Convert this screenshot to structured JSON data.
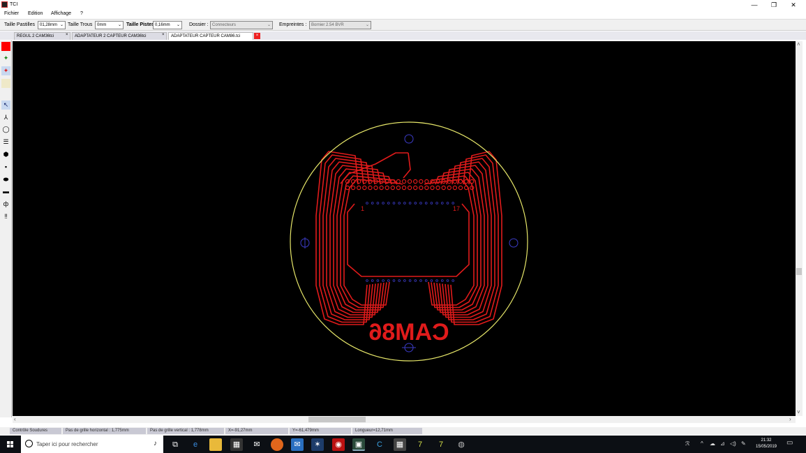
{
  "window": {
    "title": "TCI",
    "minimize": "—",
    "restore": "❐",
    "close": "✕"
  },
  "menu": [
    "Fichier",
    "Edition",
    "Affichage",
    "?"
  ],
  "toolbar": {
    "pastilles_label": "Taille Pastilles",
    "pastilles_value": "01,28mm",
    "trous_label": "Taille Trous",
    "trous_value": "0mm",
    "pistes_label": "Taille Pistes",
    "pistes_value": "0,16mm",
    "dossier_label": "Dossier :",
    "dossier_value": "Connecteurs",
    "empreintes_label": "Empreintes :",
    "empreintes_value": "Bornier 2.54 BVR"
  },
  "tabs": [
    {
      "label": "REGUL 2 CAM36tci"
    },
    {
      "label": "ADAPTATEUR 2 CAPTEUR CAM36tci"
    },
    {
      "label": "ADAPTATEUR CAPTEUR CAM86.tci"
    }
  ],
  "tab_close": "×",
  "tools": [
    "■",
    "✦",
    "✦",
    "▭",
    "↖",
    "⅄",
    "◯",
    "☰",
    "⬢",
    "▪",
    "⬬",
    "▬",
    "ф",
    "‼"
  ],
  "board": {
    "silk_text": "CAM86",
    "pin_first": "1",
    "pin_last": "17",
    "outline_color": "#e8e86a",
    "track_color": "#e01b1b",
    "via_color": "#3c3cc8",
    "background": "#000000"
  },
  "status": {
    "mode": "Contrôle Soudures",
    "grid_h": "Pas de grille horizontal : 1,775mm",
    "grid_v": "Pas de grille vertical : 1,778mm",
    "x": "X=-91,27mm",
    "y": "Y=-61,479mm",
    "length": "Longueur=12,71mm"
  },
  "taskbar": {
    "search_placeholder": "Taper ici pour rechercher",
    "apps": [
      "task-view",
      "edge",
      "file-explorer",
      "store",
      "mail",
      "firefox",
      "outlook",
      "app-a",
      "app-b",
      "tci",
      "ccleaner",
      "calculator",
      "7zip-1",
      "7zip-2",
      "misc"
    ],
    "time": "21:32",
    "date": "15/05/2019"
  }
}
